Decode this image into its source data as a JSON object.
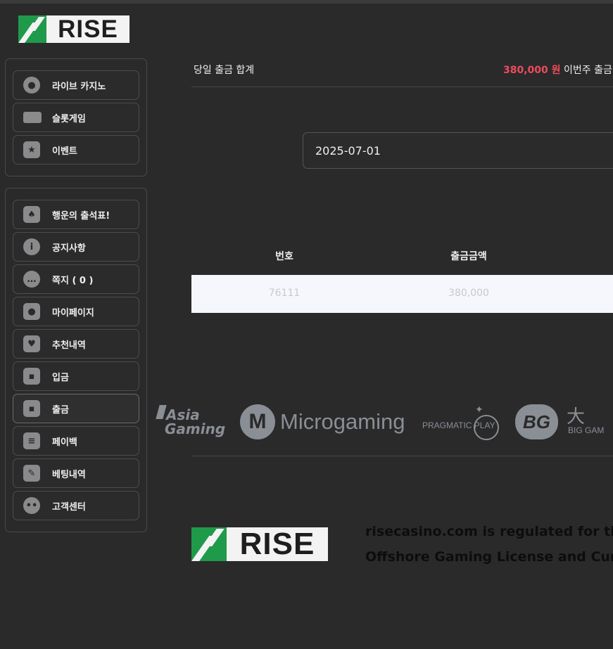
{
  "brand": {
    "logo_text": "RISE",
    "accent": "#1f9a4a"
  },
  "sidebar": {
    "group_1": [
      {
        "label": "라이브 카지노",
        "icon": "poker-chips-icon"
      },
      {
        "label": "슬롯게임",
        "icon": "slot-machine-icon"
      },
      {
        "label": "이벤트",
        "icon": "star-badge-icon"
      }
    ],
    "group_2": [
      {
        "label": "행운의 출석표!",
        "icon": "calendar-icon"
      },
      {
        "label": "공지사항",
        "icon": "info-icon"
      },
      {
        "label": "쪽지 ( 0 )",
        "icon": "chat-bubble-icon"
      },
      {
        "label": "마이페이지",
        "icon": "user-icon"
      },
      {
        "label": "추천내역",
        "icon": "heart-icon"
      },
      {
        "label": "입금",
        "icon": "wallet-in-icon"
      },
      {
        "label": "출금",
        "icon": "wallet-out-icon"
      },
      {
        "label": "페이백",
        "icon": "coins-icon"
      },
      {
        "label": "베팅내역",
        "icon": "receipt-icon"
      },
      {
        "label": "고객센터",
        "icon": "headset-icon"
      }
    ],
    "active_item": "출금"
  },
  "summary": {
    "today_label": "당일 출금 합계",
    "amount": "380,000 원",
    "week_label": "이번주 출금"
  },
  "filter": {
    "date_value": "2025-07-01"
  },
  "table": {
    "headers": {
      "number": "번호",
      "amount": "출금금액"
    },
    "rows": [
      {
        "number": "76111",
        "amount": "380,000"
      }
    ]
  },
  "providers": {
    "asia_line1": "Asia",
    "asia_line2": "Gaming",
    "microgaming": "Microgaming",
    "microgaming_mark": "M",
    "pragmatic": "PRAGMATIC PLAY",
    "bg_mark": "BG",
    "big_kanji": "大",
    "big_gaming": "BIG GAM"
  },
  "footer": {
    "line1": "risecasino.com is regulated for the",
    "line2": "Offshore Gaming License and Cura"
  }
}
